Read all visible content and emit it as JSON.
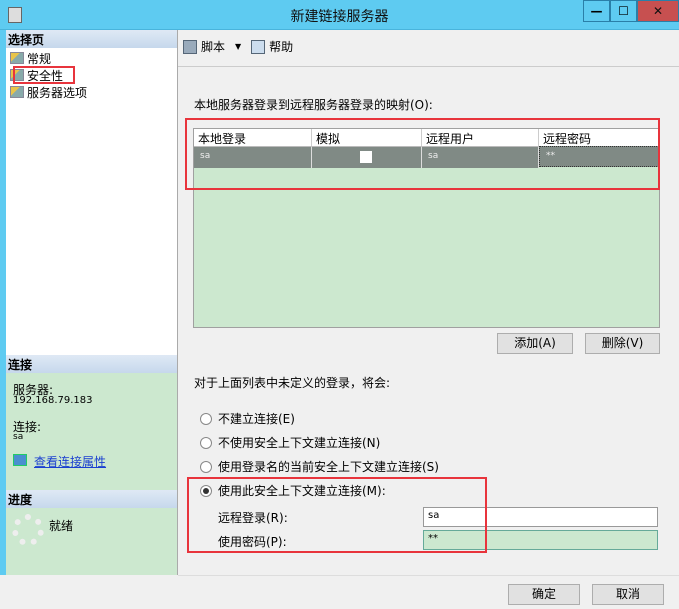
{
  "window": {
    "title": "新建链接服务器",
    "minimize": "—",
    "maximize": "☐",
    "close": "✕"
  },
  "sidebar": {
    "select_page_header": "选择页",
    "items": [
      {
        "label": "常规"
      },
      {
        "label": "安全性"
      },
      {
        "label": "服务器选项"
      }
    ],
    "connection_header": "连接",
    "server_label": "服务器:",
    "server_value": "192.168.79.183",
    "connection_label": "连接:",
    "connection_value": "sa",
    "view_properties_link": "查看连接属性",
    "progress_header": "进度",
    "progress_status": "就绪"
  },
  "toolbar": {
    "script_label": "脚本",
    "help_label": "帮助"
  },
  "mapping": {
    "label": "本地服务器登录到远程服务器登录的映射(O):",
    "columns": [
      "本地登录",
      "模拟",
      "远程用户",
      "远程密码"
    ],
    "rows": [
      {
        "local_login": "sa",
        "impersonate": false,
        "remote_user": "sa",
        "remote_password": "**"
      }
    ],
    "add_button": "添加(A)",
    "remove_button": "删除(V)"
  },
  "undefined_logins": {
    "label": "对于上面列表中未定义的登录，将会:",
    "options": [
      {
        "label": "不建立连接(E)",
        "selected": false
      },
      {
        "label": "不使用安全上下文建立连接(N)",
        "selected": false
      },
      {
        "label": "使用登录名的当前安全上下文建立连接(S)",
        "selected": false
      },
      {
        "label": "使用此安全上下文建立连接(M):",
        "selected": true
      }
    ],
    "remote_login_label": "远程登录(R):",
    "remote_login_value": "sa",
    "password_label": "使用密码(P):",
    "password_value": "**"
  },
  "footer": {
    "ok_button": "确定",
    "cancel_button": "取消"
  }
}
